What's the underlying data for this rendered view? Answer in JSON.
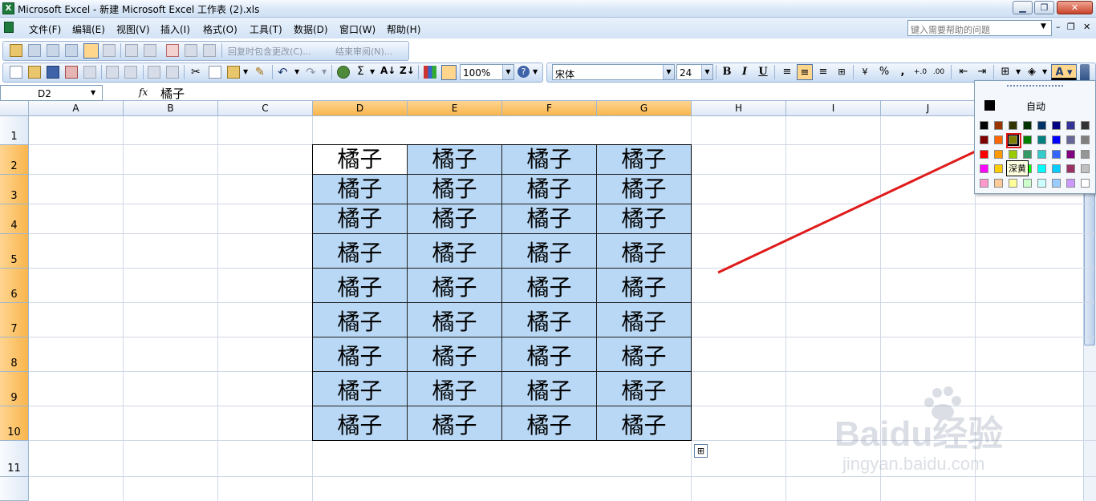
{
  "window": {
    "title": "Microsoft Excel - 新建 Microsoft Excel 工作表 (2).xls"
  },
  "menu": {
    "items": [
      "文件(F)",
      "编辑(E)",
      "视图(V)",
      "插入(I)",
      "格式(O)",
      "工具(T)",
      "数据(D)",
      "窗口(W)",
      "帮助(H)"
    ],
    "help_placeholder": "键入需要帮助的问题"
  },
  "review_toolbar": {
    "reply_changes": "回复时包含更改(C)...",
    "end_review": "结束审阅(N)..."
  },
  "standard_toolbar": {
    "zoom": "100%"
  },
  "format_toolbar": {
    "font": "宋体",
    "font_size": "24",
    "bold": "B",
    "italic": "I",
    "underline": "U",
    "percent": "%",
    "comma": ","
  },
  "formula_bar": {
    "name_box": "D2",
    "fx": "fx",
    "value": "橘子"
  },
  "sheet": {
    "columns": [
      "A",
      "B",
      "C",
      "D",
      "E",
      "F",
      "G",
      "H",
      "I",
      "J"
    ],
    "selected_columns": [
      "D",
      "E",
      "F",
      "G"
    ],
    "rows": [
      "1",
      "2",
      "3",
      "4",
      "5",
      "6",
      "7",
      "8",
      "9",
      "10",
      "11"
    ],
    "selected_rows": [
      "2",
      "3",
      "4",
      "5",
      "6",
      "7",
      "8",
      "9",
      "10"
    ],
    "active_cell": "D2",
    "cell_text": "橘子",
    "fill_color": "#b9d8f5"
  },
  "color_palette": {
    "auto_label": "自动",
    "tooltip": "深黄",
    "highlighted": "dark-yellow",
    "colors": [
      [
        "#000000",
        "#993300",
        "#333300",
        "#003300",
        "#003366",
        "#000080",
        "#333399",
        "#333333"
      ],
      [
        "#800000",
        "#ff6600",
        "#808000",
        "#008000",
        "#008080",
        "#0000ff",
        "#666699",
        "#808080"
      ],
      [
        "#ff0000",
        "#ff9900",
        "#99cc00",
        "#339966",
        "#33cccc",
        "#3366ff",
        "#800080",
        "#969696"
      ],
      [
        "#ff00ff",
        "#ffcc00",
        "#ffff00",
        "#00ff00",
        "#00ffff",
        "#00ccff",
        "#993366",
        "#c0c0c0"
      ],
      [
        "#ff99cc",
        "#ffcc99",
        "#ffff99",
        "#ccffcc",
        "#ccffff",
        "#99ccff",
        "#cc99ff",
        "#ffffff"
      ]
    ]
  },
  "watermark": {
    "brand": "Baidu经验",
    "url": "jingyan.baidu.com"
  }
}
